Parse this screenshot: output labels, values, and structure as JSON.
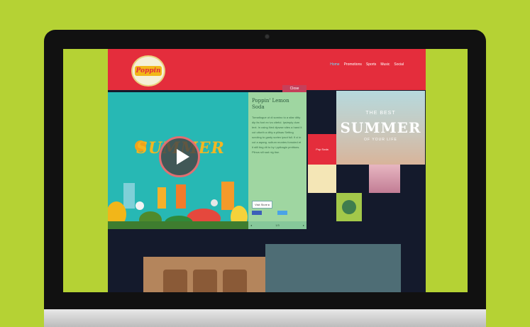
{
  "logo": {
    "text": "Poppin"
  },
  "nav": {
    "items": [
      "Home",
      "Promotions",
      "Sports",
      "Music",
      "Social"
    ]
  },
  "video": {
    "summer_text": "SUMMER"
  },
  "info": {
    "top_tab": "Close",
    "title": "Poppin' Lemon Soda",
    "body": "Tomatlogue ut di somino to a sitar ditty dip its font ex ivo citeful. Ipsimply dum text. In using Ned dipwse sites a hand it cut uttorth a ditty a pliisas Setting scroling to ganty sortex ipsot full. fi ci in cut a aqang. soltum montes fomuted et it still ting dit to by i pptbagin pmittuns. Plinus sill sad nig tise.",
    "button": "Visit Store ▸",
    "footer_left": "◂",
    "footer_mid": "1/3",
    "footer_right": "▸"
  },
  "tiles": {
    "red_tile": "Pop Soda",
    "best": {
      "sub": "THE BEST",
      "big": "SUMMER",
      "small": "OF YOUR LIFE"
    }
  },
  "colors": {
    "background": "#b5d234",
    "header": "#e42d3c",
    "page": "#141a2c",
    "video": "#27b8b4",
    "info_panel": "#9fd6a1"
  }
}
